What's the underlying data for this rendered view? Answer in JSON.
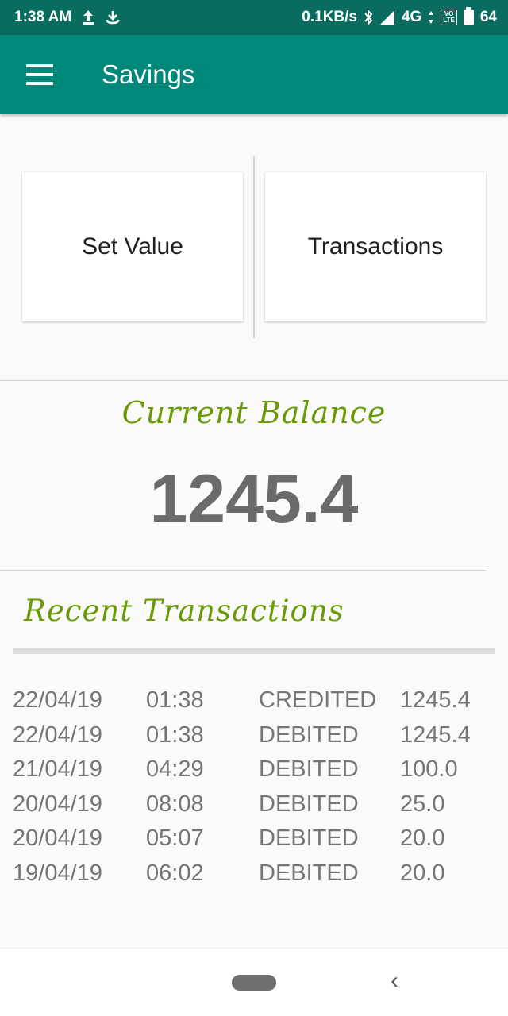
{
  "status_bar": {
    "time": "1:38 AM",
    "upload_icon": "upload-icon",
    "download_icon": "download-icon",
    "net_speed": "0.1KB/s",
    "bluetooth_icon": "bluetooth-icon",
    "signal_icon": "signal-icon",
    "network": "4G",
    "volte_top": "VO",
    "volte_bottom": "LTE",
    "battery_level": "64"
  },
  "app_bar": {
    "menu_icon": "hamburger-menu-icon",
    "title": "Savings",
    "color": "#00897b"
  },
  "cards": {
    "set_value": "Set Value",
    "transactions": "Transactions"
  },
  "balance": {
    "label": "Current Balance",
    "value": "1245.4",
    "label_color": "#6a9a07"
  },
  "recent": {
    "label": "Recent Transactions",
    "rows": [
      {
        "date": "22/04/19",
        "time": "01:38",
        "type": "CREDITED",
        "amount": "1245.4"
      },
      {
        "date": "22/04/19",
        "time": "01:38",
        "type": "DEBITED",
        "amount": "1245.4"
      },
      {
        "date": "21/04/19",
        "time": "04:29",
        "type": "DEBITED",
        "amount": "100.0"
      },
      {
        "date": "20/04/19",
        "time": "08:08",
        "type": "DEBITED",
        "amount": "25.0"
      },
      {
        "date": "20/04/19",
        "time": "05:07",
        "type": "DEBITED",
        "amount": "20.0"
      },
      {
        "date": "19/04/19",
        "time": "06:02",
        "type": "DEBITED",
        "amount": "20.0"
      }
    ]
  },
  "nav_bar": {
    "home_icon": "home-pill-icon",
    "back_icon": "back-chevron-icon",
    "back_glyph": "‹"
  }
}
